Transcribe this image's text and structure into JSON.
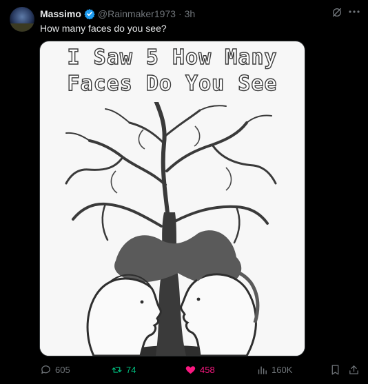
{
  "author": {
    "name": "Massimo",
    "handle": "@Rainmaker1973",
    "separator": "·",
    "time": "3h"
  },
  "post": {
    "text": "How many faces do you see?"
  },
  "media": {
    "title_line1": "I Saw 5 How Many",
    "title_line2": "Faces Do You See"
  },
  "actions": {
    "replies": "605",
    "reposts": "74",
    "likes": "458",
    "views": "160K"
  },
  "colors": {
    "background": "#000000",
    "text": "#e7e9ea",
    "muted": "#71767b",
    "verified": "#1d9bf0",
    "repost_active": "#00ba7c",
    "like_active": "#f91880"
  }
}
